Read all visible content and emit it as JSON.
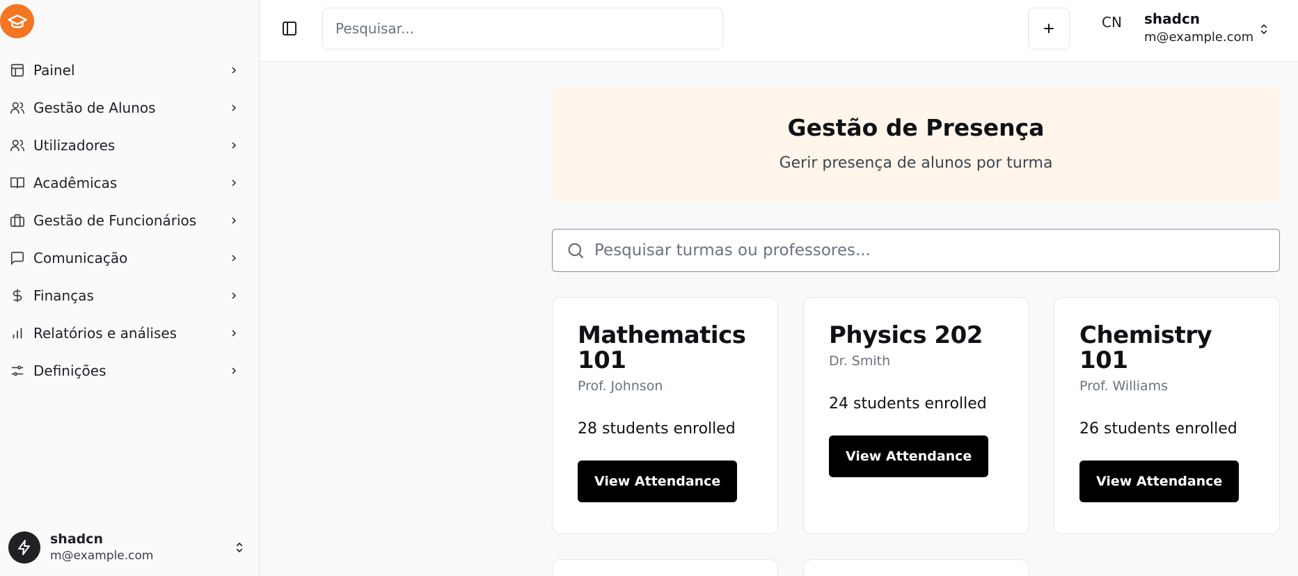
{
  "sidebar": {
    "items": [
      {
        "label": "Painel",
        "icon": "layout-icon"
      },
      {
        "label": "Gestão de Alunos",
        "icon": "users-icon"
      },
      {
        "label": "Utilizadores",
        "icon": "users-icon"
      },
      {
        "label": "Acadêmicas",
        "icon": "book-icon"
      },
      {
        "label": "Gestão de Funcionários",
        "icon": "briefcase-icon"
      },
      {
        "label": "Comunicação",
        "icon": "message-icon"
      },
      {
        "label": "Finanças",
        "icon": "dollar-icon"
      },
      {
        "label": "Relatórios e análises",
        "icon": "bar-chart-icon"
      },
      {
        "label": "Definições",
        "icon": "sliders-icon"
      }
    ],
    "user": {
      "name": "shadcn",
      "email": "m@example.com"
    }
  },
  "topbar": {
    "search_placeholder": "Pesquisar...",
    "avatar_initials": "CN",
    "user": {
      "name": "shadcn",
      "email": "m@example.com"
    }
  },
  "hero": {
    "title": "Gestão de Presença",
    "subtitle": "Gerir presença de alunos por turma"
  },
  "main_search": {
    "placeholder": "Pesquisar turmas ou professores..."
  },
  "classes": [
    {
      "title": "Mathematics 101",
      "teacher": "Prof. Johnson",
      "enrolled": "28 students enrolled",
      "button": "View Attendance"
    },
    {
      "title": "Physics 202",
      "teacher": "Dr. Smith",
      "enrolled": "24 students enrolled",
      "button": "View Attendance"
    },
    {
      "title": "Chemistry 101",
      "teacher": "Prof. Williams",
      "enrolled": "26 students enrolled",
      "button": "View Attendance"
    }
  ],
  "colors": {
    "brand": "#f47522",
    "hero_bg": "#fff5ea",
    "button_bg": "#000000"
  }
}
